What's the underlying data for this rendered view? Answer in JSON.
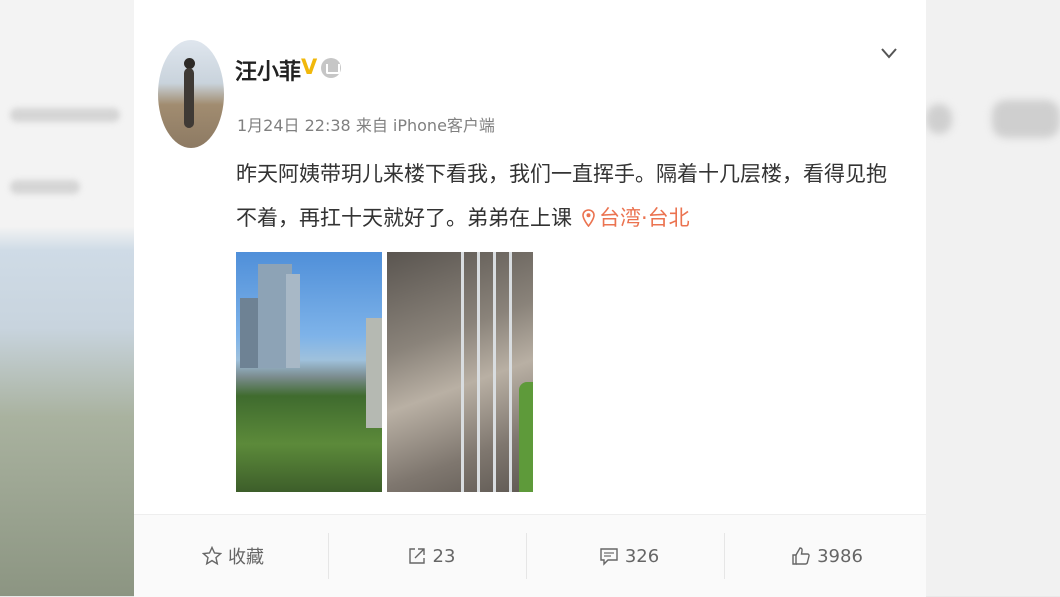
{
  "post": {
    "author": "汪小菲",
    "verified_badge": "V",
    "meta": "1月24日 22:38 来自 iPhone客户端",
    "text": "昨天阿姨带玥儿来楼下看我，我们一直挥手。隔着十几层楼，看得见抱不着，再扛十天就好了。弟弟在上课",
    "location": "台湾·台北"
  },
  "actions": {
    "favorite_label": "收藏",
    "repost_count": "23",
    "comment_count": "326",
    "like_count": "3986"
  },
  "colors": {
    "accent_location": "#eb7350",
    "verified": "#f1b80b"
  }
}
